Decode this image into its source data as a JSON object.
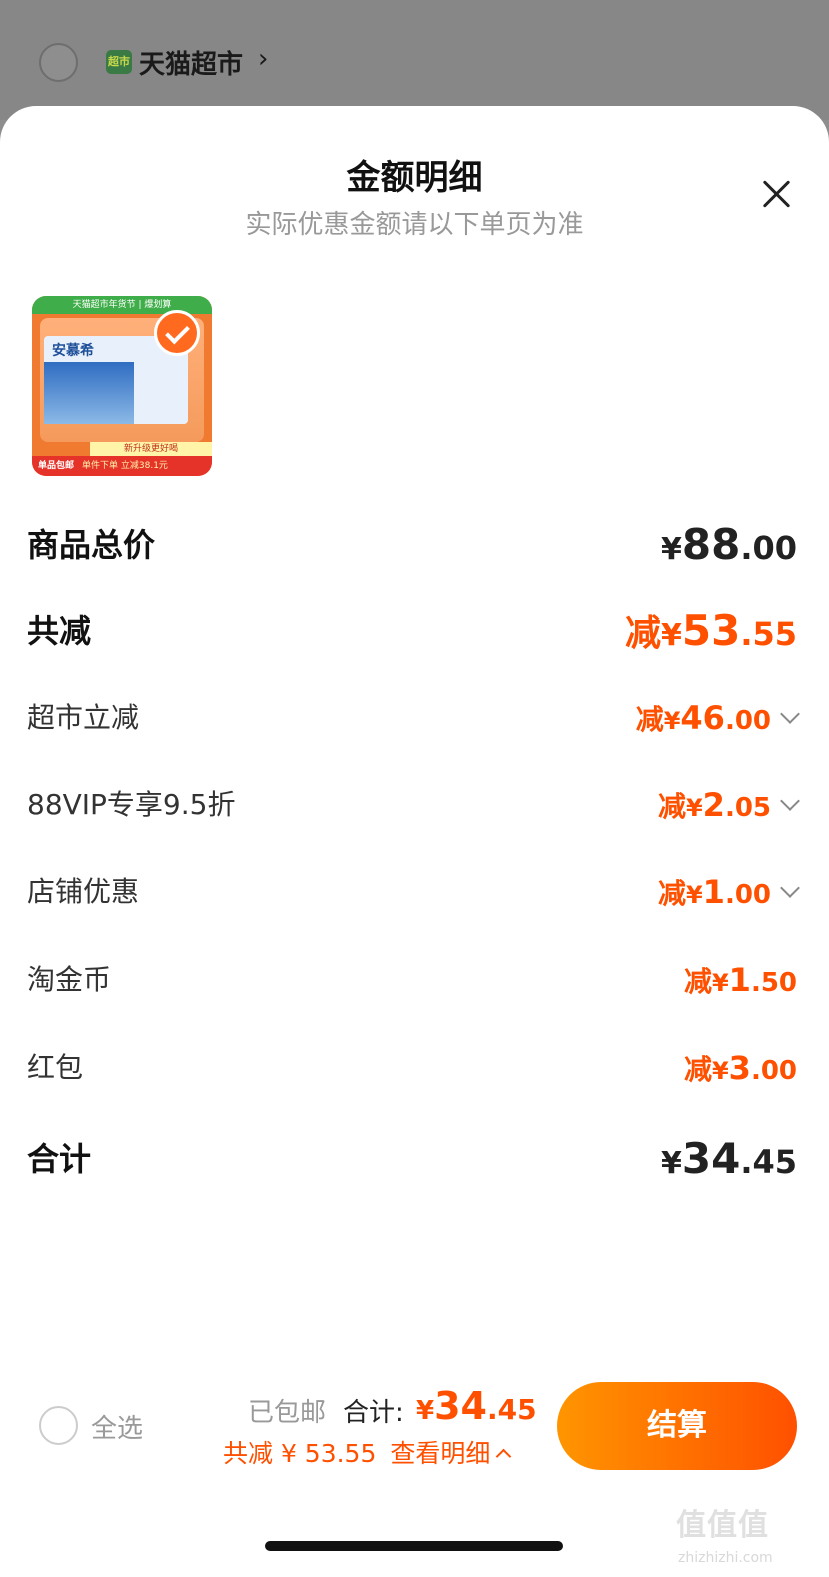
{
  "store": {
    "name": "天猫超市",
    "logo_text": "超市"
  },
  "sheet": {
    "title": "金额明细",
    "subtitle": "实际优惠金额请以下单页为准"
  },
  "product": {
    "banner_top": "天猫超市年货节 | 爆划算",
    "brand": "安慕希",
    "promo_strip": "新升级更好喝",
    "bottom_left": "单品包邮",
    "bottom_right": "单件下单 立减38.1元",
    "selected": true
  },
  "rows": {
    "total_price": {
      "label": "商品总价",
      "currency": "¥",
      "int": "88",
      "dec": ".00"
    },
    "total_discount": {
      "label": "共减",
      "prefix": "减",
      "currency": "¥",
      "int": "53",
      "dec": ".55"
    },
    "market_discount": {
      "label": "超市立减",
      "prefix": "减",
      "currency": "¥",
      "int": "46",
      "dec": ".00"
    },
    "vip_discount": {
      "label": "88VIP专享9.5折",
      "prefix": "减",
      "currency": "¥",
      "int": "2",
      "dec": ".05"
    },
    "shop_discount": {
      "label": "店铺优惠",
      "prefix": "减",
      "currency": "¥",
      "int": "1",
      "dec": ".00"
    },
    "tao_coin": {
      "label": "淘金币",
      "prefix": "减",
      "currency": "¥",
      "int": "1",
      "dec": ".50"
    },
    "red_packet": {
      "label": "红包",
      "prefix": "减",
      "currency": "¥",
      "int": "3",
      "dec": ".00"
    },
    "sum": {
      "label": "合计",
      "currency": "¥",
      "int": "34",
      "dec": ".45"
    }
  },
  "bottom_bar": {
    "select_all": "全选",
    "shipping": "已包邮",
    "total_label": "合计:",
    "total_currency": "¥",
    "total_int": "34",
    "total_dec": ".45",
    "discount_text": "共减 ¥ 53.55",
    "view_details": "查看明细",
    "checkout": "结算"
  },
  "watermark": {
    "text": "值值值",
    "sub": "zhizhizhi.com"
  },
  "colors": {
    "accent": "#ff5000",
    "gradient_start": "#ff9500"
  }
}
